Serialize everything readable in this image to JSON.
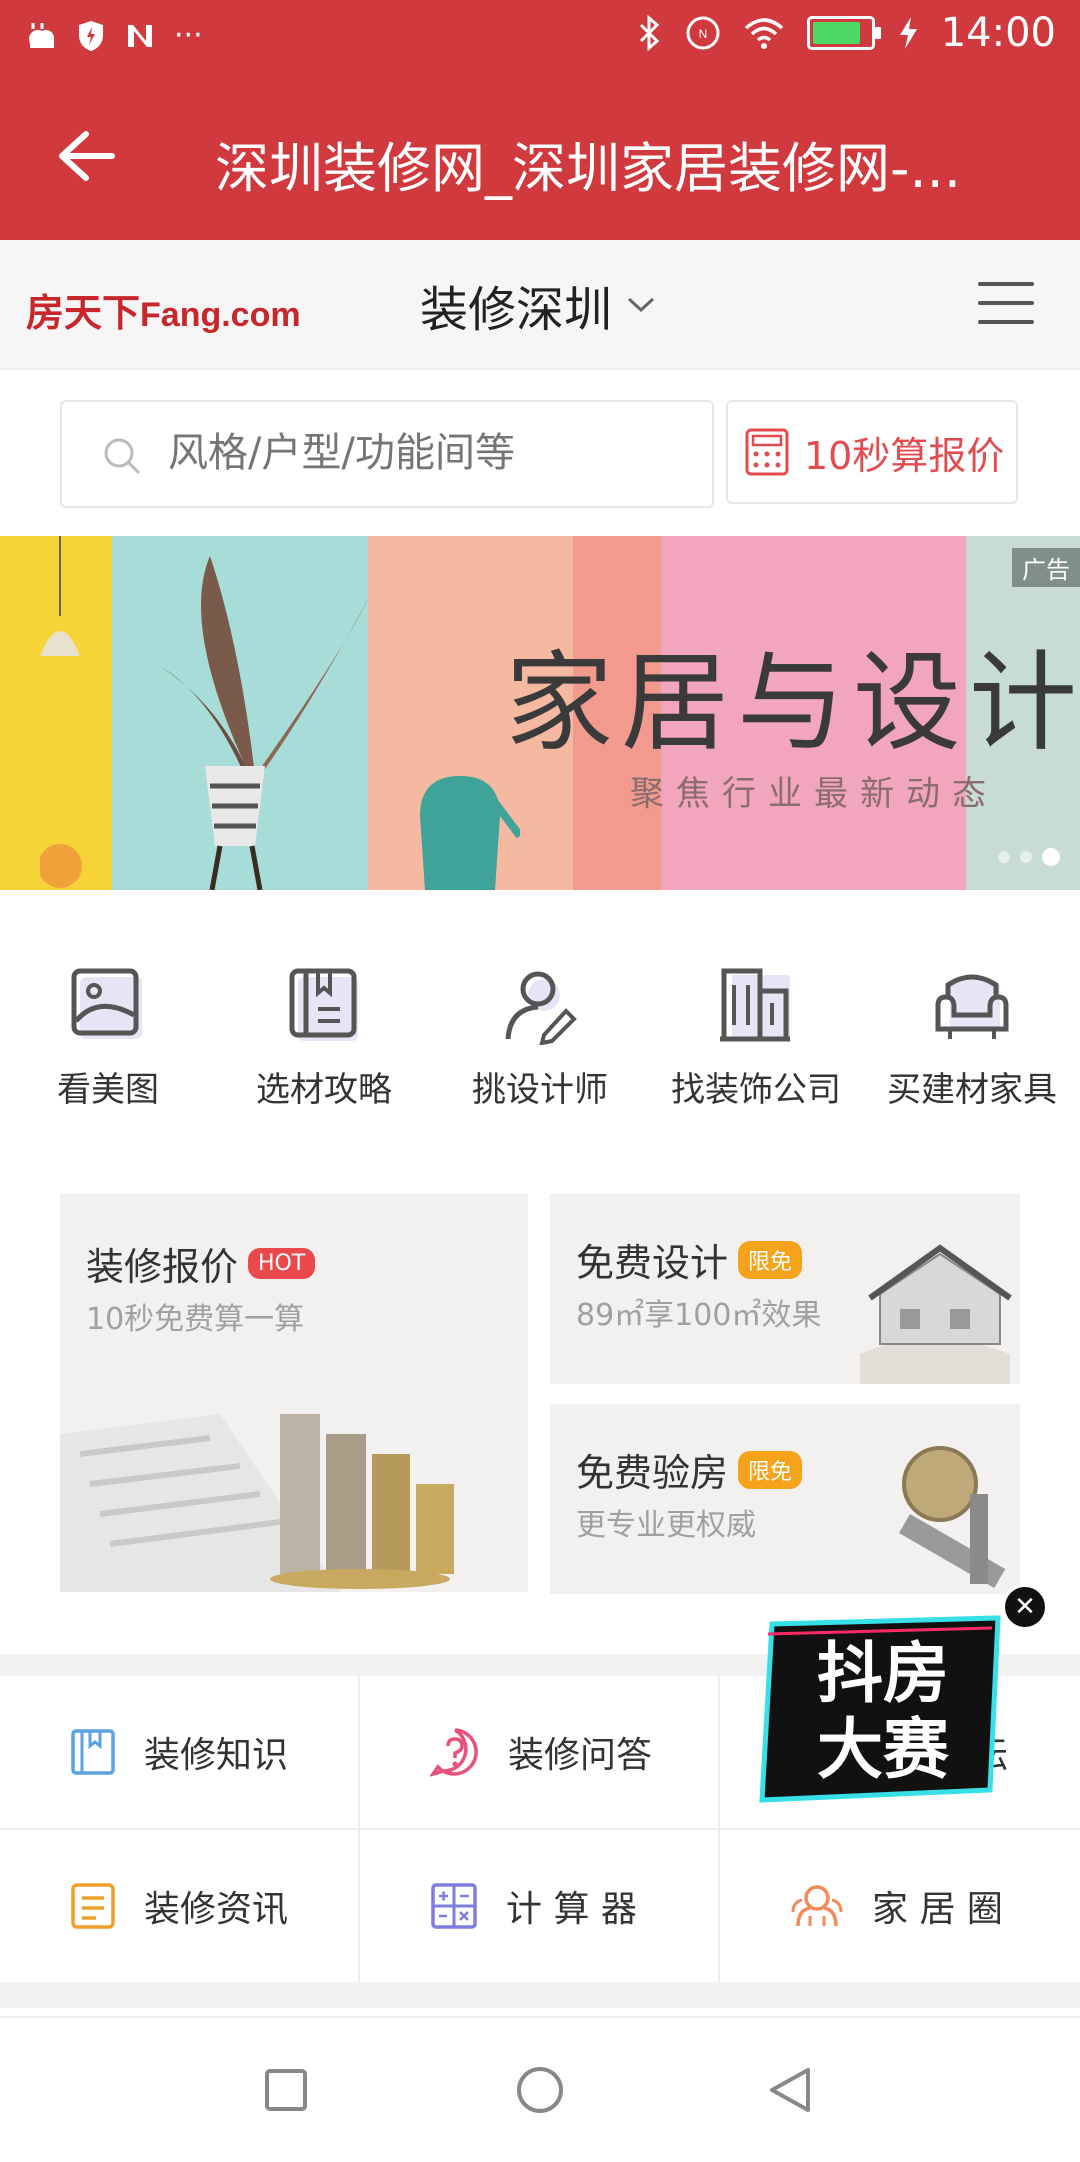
{
  "status_bar": {
    "time": "14:00",
    "left_icons": [
      "weather-icon",
      "shield-icon",
      "n-icon",
      "more-icon"
    ],
    "right_icons": [
      "bluetooth-icon",
      "nfc-icon",
      "wifi-icon",
      "battery-icon",
      "charging-icon"
    ],
    "battery_level": 0.85
  },
  "title_bar": {
    "title": "深圳装修网_深圳家居装修网-...",
    "bg_color": "#d0393d"
  },
  "header": {
    "logo_cn": "房天下",
    "logo_en": "Fang.com",
    "city_selector": "装修深圳"
  },
  "search": {
    "placeholder": "风格/户型/功能间等",
    "quote_button": "10秒算报价"
  },
  "banner": {
    "title": "家居与设计",
    "subtitle": "聚焦行业最新动态",
    "ad_label": "广告",
    "active_dot": 3,
    "dot_count": 3
  },
  "quick_links": [
    {
      "label": "看美图",
      "icon": "image-icon"
    },
    {
      "label": "选材攻略",
      "icon": "book-icon"
    },
    {
      "label": "挑设计师",
      "icon": "designer-icon"
    },
    {
      "label": "找装饰公司",
      "icon": "building-icon"
    },
    {
      "label": "买建材家具",
      "icon": "sofa-icon"
    }
  ],
  "cards": {
    "quote": {
      "title": "装修报价",
      "tag": "HOT",
      "subtitle": "10秒免费算一算"
    },
    "design": {
      "title": "免费设计",
      "tag": "限免",
      "subtitle": "89㎡享100㎡效果"
    },
    "inspect": {
      "title": "免费验房",
      "tag": "限免",
      "subtitle": "更专业更权威"
    }
  },
  "grid": [
    {
      "label": "装修知识",
      "icon": "knowledge-icon"
    },
    {
      "label": "装修问答",
      "icon": "question-icon"
    },
    {
      "label": "坛",
      "icon": "forum-icon"
    },
    {
      "label": "装修资讯",
      "icon": "news-icon"
    },
    {
      "label": "计 算 器",
      "icon": "calculator-icon"
    },
    {
      "label": "家 居 圈",
      "icon": "community-icon"
    }
  ],
  "promo": {
    "line1": "抖房",
    "line2": "大赛"
  },
  "colors": {
    "brand_red": "#d0393d",
    "accent_red": "#e24b4f",
    "tag_orange": "#f5a31a"
  }
}
